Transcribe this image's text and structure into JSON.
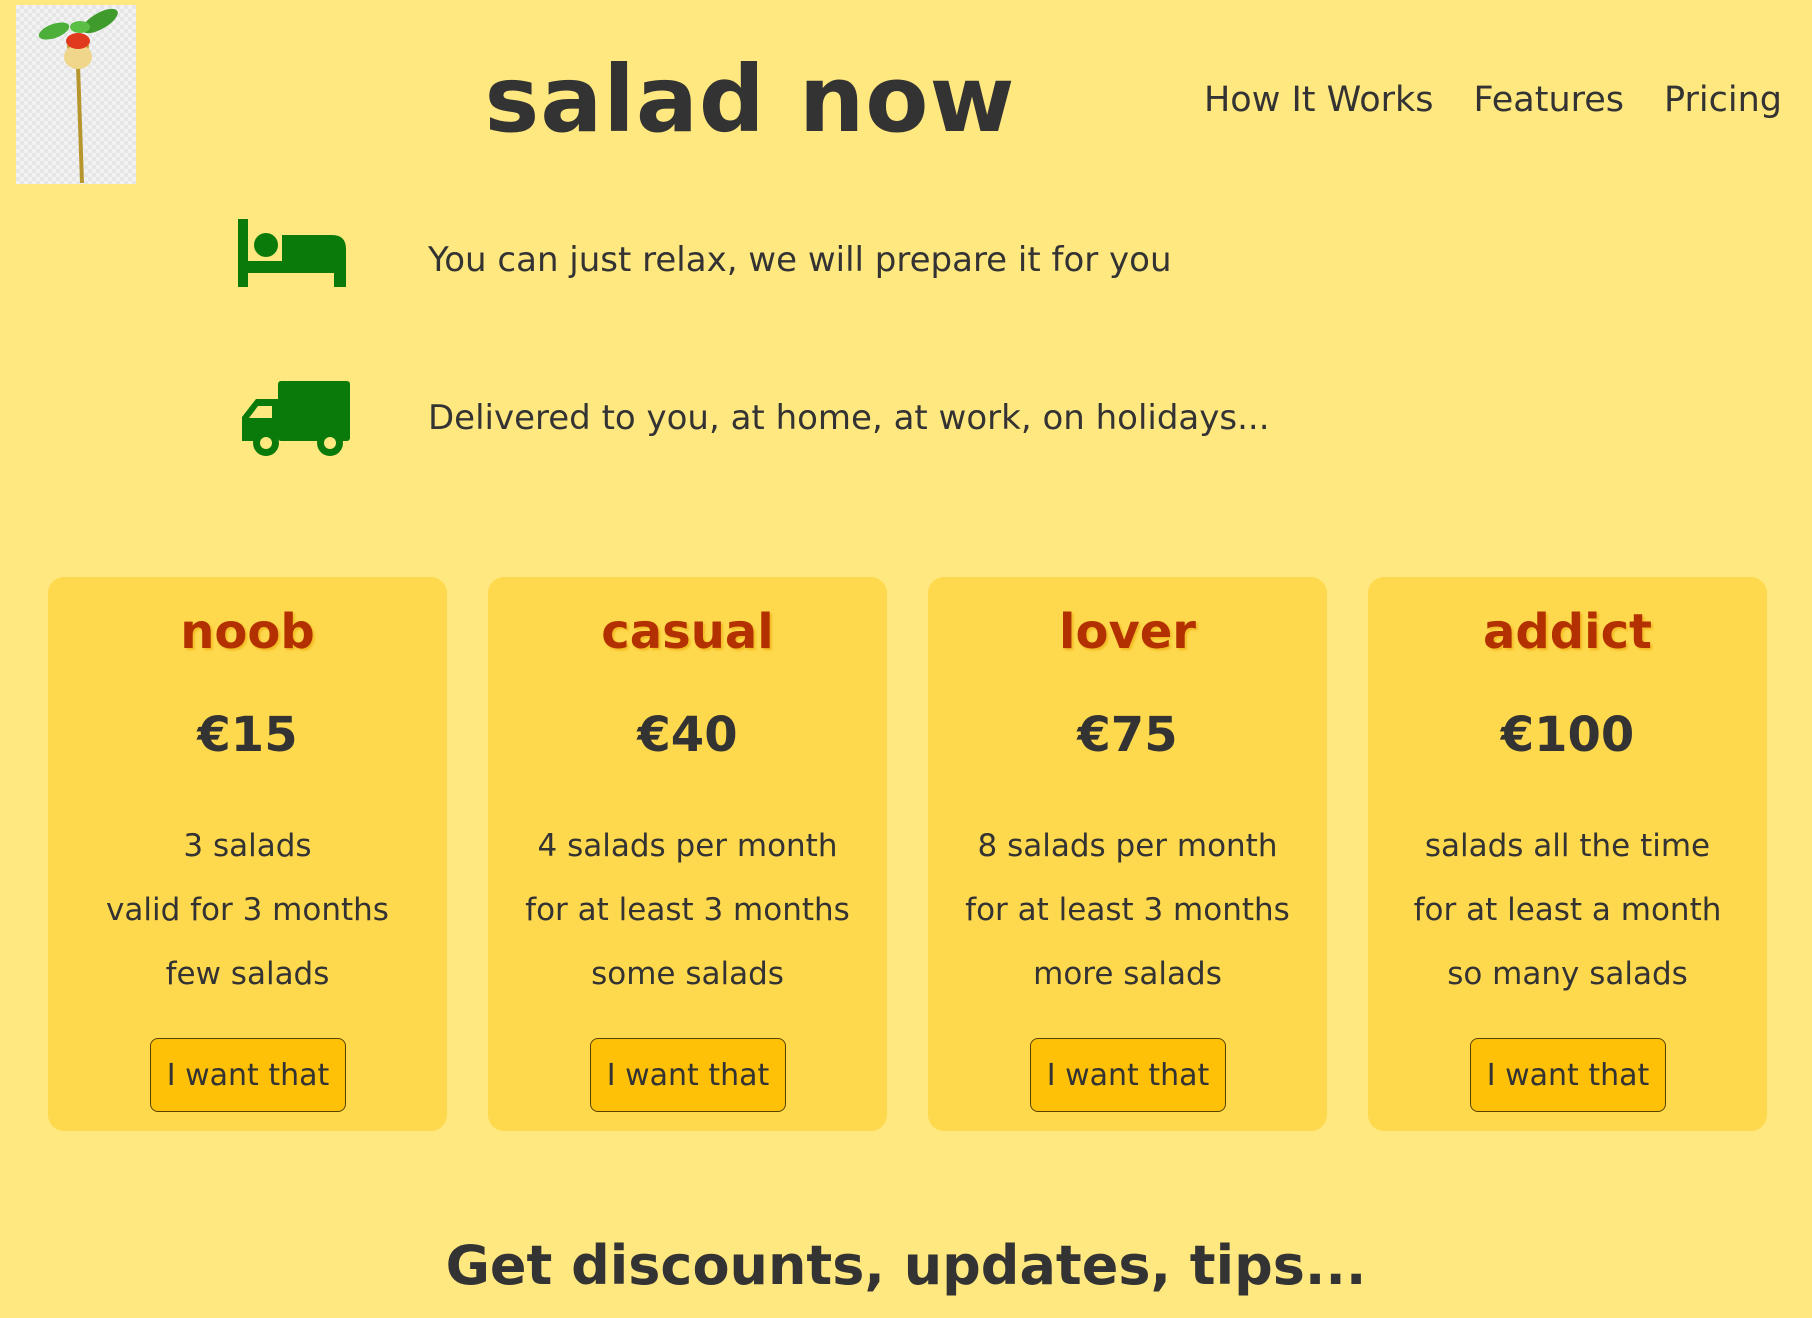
{
  "header": {
    "title": "salad now",
    "nav": [
      {
        "label": "How It Works"
      },
      {
        "label": "Features"
      },
      {
        "label": "Pricing"
      }
    ]
  },
  "features": [
    {
      "icon": "bed-icon",
      "text": "You can just relax, we will prepare it for you"
    },
    {
      "icon": "truck-icon",
      "text": "Delivered to you, at home, at work, on holidays..."
    }
  ],
  "plans": [
    {
      "name": "noob",
      "price": "€15",
      "features": [
        "3 salads",
        "valid for 3 months",
        "few salads"
      ],
      "button": "I want that"
    },
    {
      "name": "casual",
      "price": "€40",
      "features": [
        "4 salads per month",
        "for at least 3 months",
        "some salads"
      ],
      "button": "I want that"
    },
    {
      "name": "lover",
      "price": "€75",
      "features": [
        "8 salads per month",
        "for at least 3 months",
        "more salads"
      ],
      "button": "I want that"
    },
    {
      "name": "addict",
      "price": "€100",
      "features": [
        "salads all the time",
        "for at least a month",
        "so many salads"
      ],
      "button": "I want that"
    }
  ],
  "signup": {
    "heading": "Get discounts, updates, tips..."
  },
  "colors": {
    "background": "#ffe880",
    "card": "#ffd94d",
    "plan_name": "#b33000",
    "button": "#ffc107",
    "icon": "#0a7a0a",
    "text": "#333333"
  }
}
